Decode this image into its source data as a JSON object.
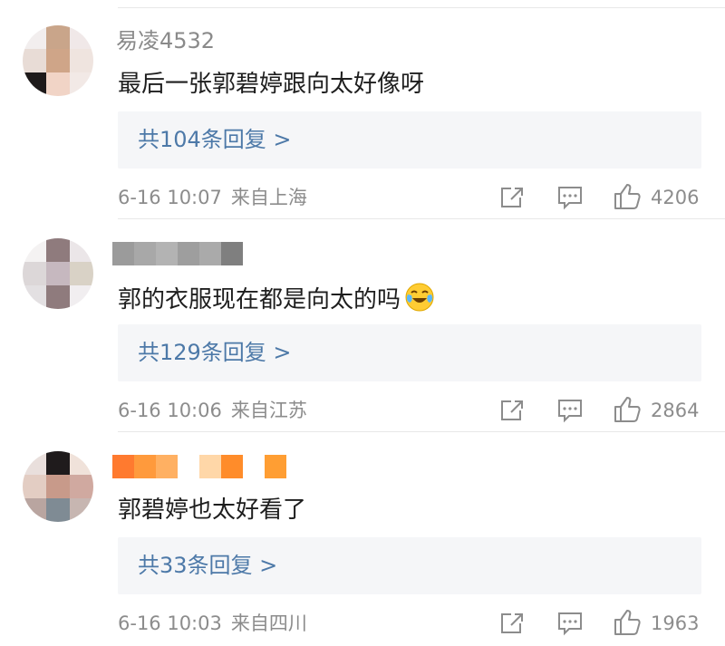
{
  "comments": [
    {
      "username": "易凌4532",
      "content": "最后一张郭碧婷跟向太好像呀",
      "emoji": "",
      "reply_label": "共104条回复 >",
      "time": "6-16 10:07",
      "location": "来自上海",
      "likes": "4206",
      "avatar_colors": [
        "#f2eeee",
        "#c9a58a",
        "#f0e8e8",
        "#e8dcd6",
        "#cfa588",
        "#efe4df",
        "#1e1a1a",
        "#f1d4c6",
        "#f2e9e6"
      ],
      "name_mosaic": []
    },
    {
      "username": "",
      "content": "郭的衣服现在都是向太的吗",
      "emoji": "laughing-crying-emoji",
      "reply_label": "共129条回复 >",
      "time": "6-16 10:06",
      "location": "来自江苏",
      "likes": "2864",
      "avatar_colors": [
        "#f4f2f2",
        "#8f7b7d",
        "#ebe6e8",
        "#dcd7d8",
        "#c6b8bf",
        "#d9d2c6",
        "#e3e0e2",
        "#8f7b7d",
        "#f1eef0"
      ],
      "name_mosaic": [
        "#9b9b9b",
        "#a8a8a8",
        "#b3b3b3",
        "#9e9e9e",
        "#aaaaaa",
        "#7f7f7f"
      ]
    },
    {
      "username": "",
      "content": "郭碧婷也太好看了",
      "emoji": "",
      "reply_label": "共33条回复 >",
      "time": "6-16 10:03",
      "location": "来自四川",
      "likes": "1963",
      "avatar_colors": [
        "#e9dfdc",
        "#1f1b1c",
        "#f0e2da",
        "#e3cdc3",
        "#c89a8a",
        "#d0a9a0",
        "#b9a5a0",
        "#7f8b94",
        "#c7b6b1"
      ],
      "name_mosaic": [
        "#ff7a2f",
        "#ff9a3c",
        "#ffb062",
        "#ffffff",
        "#ffd7a8",
        "#ff8c2a",
        "#ffffff",
        "#ff9e33"
      ]
    }
  ]
}
